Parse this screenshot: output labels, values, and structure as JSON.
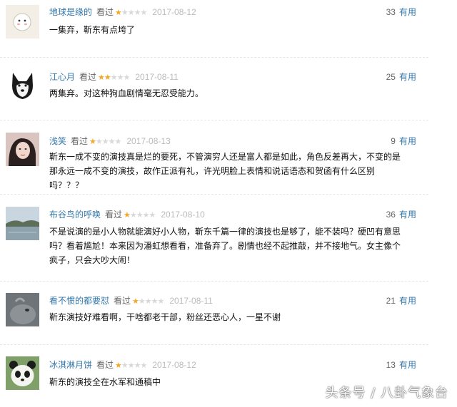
{
  "reviews": [
    {
      "user": "地球是缘的",
      "seen": "看过",
      "rating": 1,
      "date": "2017-08-12",
      "count": "33",
      "useful_label": "有用",
      "content": "一集弃，靳东有点垮了"
    },
    {
      "user": "江心月",
      "seen": "看过",
      "rating": 2,
      "date": "2017-08-11",
      "count": "25",
      "useful_label": "有用",
      "content": "两集弃。对这种狗血剧情毫无忍受能力。"
    },
    {
      "user": "浅笑",
      "seen": "看过",
      "rating": 1,
      "date": "2017-08-13",
      "count": "9",
      "useful_label": "有用",
      "content": "靳东一成不变的演技真是烂的要死，不管演穷人还是富人都是如此，角色反差再大，不变的是那永远一成不变的演技，故作正派有礼，许光明脸上表情和说话语态和贺函有什么区别吗？？？"
    },
    {
      "user": "布谷鸟的呼唤",
      "seen": "看过",
      "rating": 1,
      "date": "2017-08-10",
      "count": "36",
      "useful_label": "有用",
      "content": "不是说演的是小人物就能演好小人物，靳东千篇一律的演技也是够了，能不装吗？硬凹有意思吗？看着尴尬！本来因为潘虹想看看，准备弃了。剧情也经不起推敲，并不接地气。女主像个疯子，只会大吵大闹！"
    },
    {
      "user": "看不惯的都要怼",
      "seen": "看过",
      "rating": 1,
      "date": "2017-08-11",
      "count": "21",
      "useful_label": "有用",
      "content": "靳东演技好难看啊，干啥都老干部，粉丝还恶心人，一星不谢"
    },
    {
      "user": "冰淇淋月饼",
      "seen": "看过",
      "rating": 1,
      "date": "2017-08-12",
      "count": "13",
      "useful_label": "有用",
      "content": "靳东的演技全在水军和通稿中"
    }
  ],
  "watermark": "头条号 / 八卦气象台",
  "colors": {
    "link": "#3377aa",
    "star_on": "#f5a623",
    "star_off": "#d8d8d8",
    "date": "#bbbbbb"
  },
  "avatars": [
    "cartoon-face-icon",
    "husky-dog-icon",
    "woman-portrait-icon",
    "lake-landscape-icon",
    "gray-animal-icon",
    "panda-icon"
  ]
}
